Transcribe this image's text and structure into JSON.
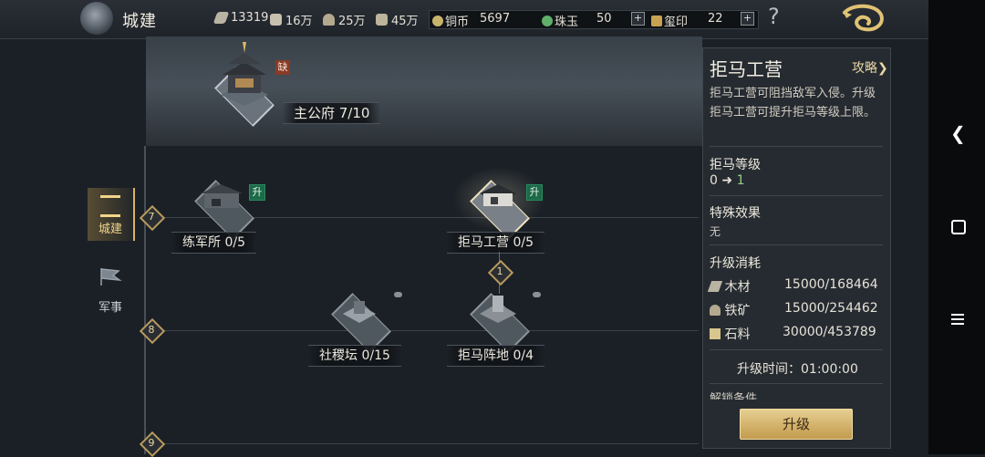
{
  "header": {
    "title": "城建",
    "resources": [
      {
        "icon": "wood-icon",
        "value": "13319"
      },
      {
        "icon": "scroll-icon",
        "value": "16万"
      },
      {
        "icon": "ore-icon",
        "value": "25万"
      },
      {
        "icon": "stone-icon",
        "value": "45万"
      }
    ],
    "currencies": [
      {
        "icon": "copper-coin-icon",
        "label": "铜币",
        "value": "5697"
      },
      {
        "icon": "jade-icon",
        "label": "珠玉",
        "value": "50"
      },
      {
        "icon": "seal-icon",
        "label": "玺印",
        "value": "22"
      }
    ],
    "help": "?"
  },
  "tabs": [
    {
      "label": "城建",
      "icon": "city-icon",
      "active": true
    },
    {
      "label": "军事",
      "icon": "flag-icon",
      "active": false
    }
  ],
  "tree": {
    "main_building": {
      "label": "主公府 7/10",
      "badge": "缺"
    },
    "levels": [
      "7",
      "8",
      "9"
    ],
    "buildings": [
      {
        "label": "练军所 0/5",
        "badge": "升"
      },
      {
        "label": "拒马工营 0/5",
        "badge": "升"
      },
      {
        "label": "社稷坛 0/15"
      },
      {
        "label": "拒马阵地 0/4"
      }
    ],
    "connector": "1"
  },
  "panel": {
    "title": "拒马工营",
    "guide_link": "攻略",
    "description": "拒马工营可阻挡敌军入侵。升级拒马工营可提升拒马等级上限。",
    "level_heading": "拒马等级",
    "level_from": "0",
    "level_to": "1",
    "effect_heading": "特殊效果",
    "effect_value": "无",
    "cost_heading": "升级消耗",
    "costs": [
      {
        "icon": "wood-icon",
        "label": "木材",
        "value": "15000/168464"
      },
      {
        "icon": "ore-icon",
        "label": "铁矿",
        "value": "15000/254462"
      },
      {
        "icon": "stone-icon",
        "label": "石料",
        "value": "30000/453789"
      }
    ],
    "time_label": "升级时间：01:00:00",
    "cut_heading": "解锁条件",
    "upgrade_button": "升级"
  },
  "colors": {
    "gold": "#d9b461",
    "green": "#8fd18a",
    "panel": "#262b31"
  }
}
